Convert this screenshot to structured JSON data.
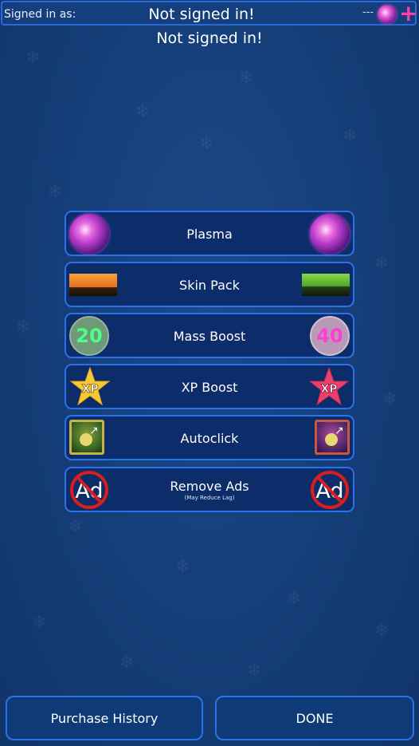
{
  "header": {
    "signed_in_label": "Signed in as:",
    "signed_in_value": "Not signed in!",
    "currency_count": "---",
    "currency_icon": "plasma-orb-icon",
    "add_icon": "plus-icon"
  },
  "subtitle": "Not signed in!",
  "shop_items": [
    {
      "label": "Plasma",
      "left_icon": "plasma-orb-icon",
      "right_icon": "plasma-orb-icon"
    },
    {
      "label": "Skin Pack",
      "left_icon": "halloween-pumpkins-icon",
      "right_icon": "halloween-bat-icon"
    },
    {
      "label": "Mass Boost",
      "left_icon": "mass-20-icon",
      "left_value": "20",
      "right_icon": "mass-40-icon",
      "right_value": "40"
    },
    {
      "label": "XP Boost",
      "left_icon": "xp-star-gold-icon",
      "left_value": "XP",
      "right_icon": "xp-star-red-icon",
      "right_value": "XP"
    },
    {
      "label": "Autoclick",
      "left_icon": "autoclick-gold-icon",
      "right_icon": "autoclick-red-icon"
    },
    {
      "label": "Remove Ads",
      "sublabel": "(May Reduce Lag)",
      "left_icon": "no-ads-icon",
      "left_value": "Ad",
      "right_icon": "no-ads-icon",
      "right_value": "Ad"
    }
  ],
  "footer": {
    "purchase_history_label": "Purchase History",
    "done_label": "DONE"
  },
  "colors": {
    "background": "#163f7a",
    "button_border": "#2a72ea",
    "button_fill": "#0c2d6a",
    "plus": "#ff3fa8"
  }
}
